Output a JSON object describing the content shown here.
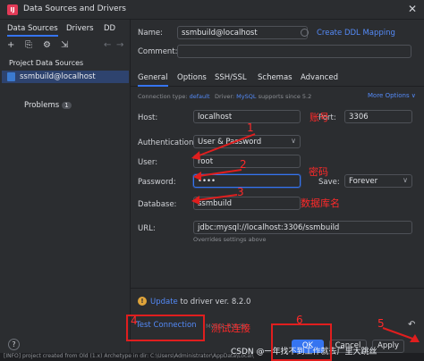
{
  "window": {
    "title": "Data Sources and Drivers",
    "close": "✕"
  },
  "left": {
    "tabs": [
      "Data Sources",
      "Drivers",
      "DD"
    ],
    "toolbar": [
      "+",
      "⎘",
      "⚙",
      "⇲"
    ],
    "nav": [
      "←",
      "→"
    ],
    "section_title": "Project Data Sources",
    "selected_item": "ssmbuild@localhost",
    "problems_label": "Problems",
    "problems_count": "1",
    "help": "?"
  },
  "form": {
    "name_label": "Name:",
    "name_value": "ssmbuild@localhost",
    "create_ddl": "Create DDL Mapping",
    "comment_label": "Comment:",
    "comment_value": "",
    "tabs": [
      "General",
      "Options",
      "SSH/SSL",
      "Schemas",
      "Advanced"
    ],
    "conn_type_label": "Connection type:",
    "conn_type_value": "default",
    "driver_label": "Driver:",
    "driver_value": "MySQL",
    "driver_note": "supports since 5.2",
    "more_options": "More Options ∨",
    "host_label": "Host:",
    "host_value": "localhost",
    "port_label": "Port:",
    "port_value": "3306",
    "auth_label": "Authentication:",
    "auth_value": "User & Password",
    "user_label": "User:",
    "user_value": "root",
    "password_label": "Password:",
    "password_value": "••••",
    "save_label": "Save:",
    "save_value": "Forever",
    "database_label": "Database:",
    "database_value": "ssmbuild",
    "url_label": "URL:",
    "url_value": "jdbc:mysql://localhost:3306/ssmbuild",
    "url_note": "Overrides settings above"
  },
  "footer": {
    "update_text_link": "Update",
    "update_text_rest": "to driver ver. 8.2.0",
    "test_connection": "Test Connection",
    "mysql_version": "MySQL 8.0.28",
    "ok": "OK",
    "cancel": "Cancel",
    "apply": "Apply",
    "revert": "↶"
  },
  "annotations": {
    "n1": "1",
    "n2": "2",
    "n3": "3",
    "n4": "4",
    "n5": "5",
    "n6": "6",
    "account": "账号",
    "password": "密码",
    "dbname": "数据库名",
    "test": "测试连接"
  },
  "terminal_text": "[INFO] project created from Old (1.x) Archetype in dir: C:\\Users\\Administrator\\AppData\\Local\\",
  "watermark": "CSDN @一年找不到工作就去广里大跳丝",
  "colors": {
    "accent": "#3574f0",
    "annotation": "#e01e1e",
    "background": "#2b2d30"
  }
}
